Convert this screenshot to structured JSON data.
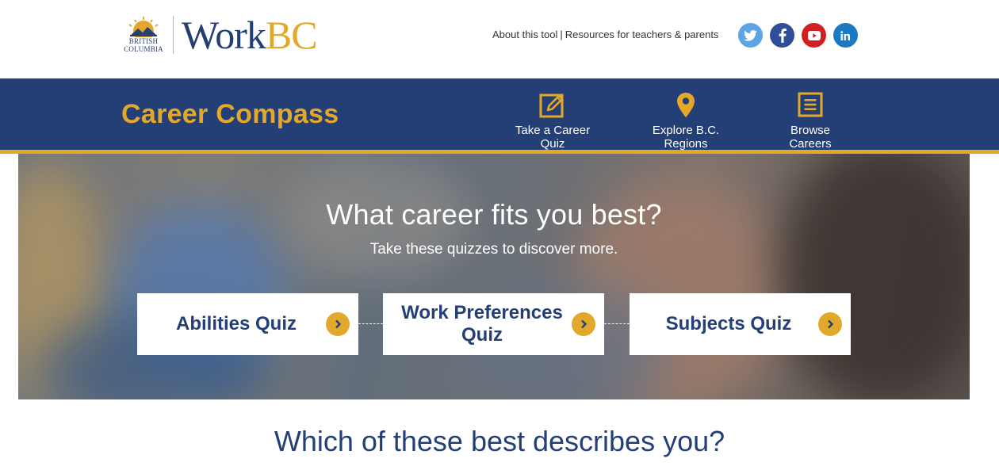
{
  "header": {
    "logo_text": "BRITISH COLUMBIA",
    "brand_word": "Work",
    "brand_suffix": "BC",
    "links": {
      "about": "About this tool",
      "separator": "|",
      "resources": "Resources for teachers & parents"
    },
    "social": [
      {
        "name": "twitter-icon",
        "color": "#5ba4e5"
      },
      {
        "name": "facebook-icon",
        "color": "#2f4e9a"
      },
      {
        "name": "youtube-icon",
        "color": "#d21f21"
      },
      {
        "name": "linkedin-icon",
        "color": "#1b79c4"
      }
    ]
  },
  "nav": {
    "brand": "Career Compass",
    "items": [
      {
        "label": "Take a Career Quiz",
        "icon": "edit-icon"
      },
      {
        "label": "Explore B.C. Regions",
        "icon": "location-pin-icon"
      },
      {
        "label": "Browse Careers",
        "icon": "list-icon"
      }
    ]
  },
  "hero": {
    "title": "What career fits you best?",
    "subtitle": "Take these quizzes to discover more.",
    "quizzes": [
      {
        "label": "Abilities Quiz"
      },
      {
        "label": "Work Preferences Quiz"
      },
      {
        "label": "Subjects Quiz"
      }
    ]
  },
  "section": {
    "title": "Which of these best describes you?"
  },
  "colors": {
    "navy": "#233f76",
    "gold": "#e4a829",
    "white": "#ffffff"
  }
}
